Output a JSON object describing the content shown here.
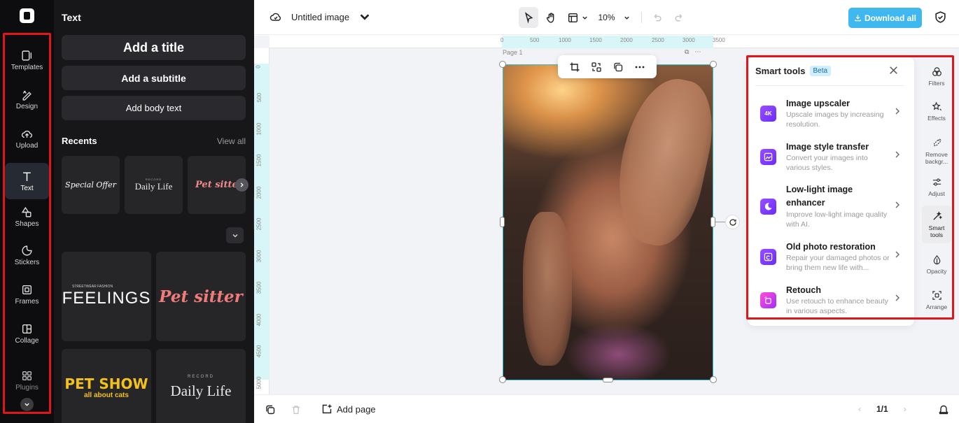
{
  "rail": {
    "items": [
      {
        "label": "Templates",
        "icon": "templates-icon"
      },
      {
        "label": "Design",
        "icon": "design-icon"
      },
      {
        "label": "Upload",
        "icon": "upload-icon"
      },
      {
        "label": "Text",
        "icon": "text-icon"
      },
      {
        "label": "Shapes",
        "icon": "shapes-icon"
      },
      {
        "label": "Stickers",
        "icon": "stickers-icon"
      },
      {
        "label": "Frames",
        "icon": "frames-icon"
      },
      {
        "label": "Collage",
        "icon": "collage-icon"
      },
      {
        "label": "Plugins",
        "icon": "plugins-icon"
      }
    ],
    "active": "Text"
  },
  "panel": {
    "title": "Text",
    "add_title": "Add a title",
    "add_subtitle": "Add a subtitle",
    "add_body": "Add body text",
    "recents_label": "Recents",
    "view_all": "View all",
    "recents": {
      "special_offer": "Special Offer",
      "daily_small": "RECORD",
      "daily_big": "Daily Life",
      "pet_sitter": "Pet sitter"
    },
    "templates": {
      "feelings_tiny": "STREETWEAR FASHION",
      "feelings": "FEELINGS",
      "pet_sitter": "Pet sitter",
      "pet_show": "PET SHOW",
      "pet_show_sub": "all about cats",
      "daily_small": "RECORD",
      "daily_big": "Daily Life"
    }
  },
  "topbar": {
    "doc_name": "Untitled image",
    "zoom": "10%",
    "download": "Download all"
  },
  "canvas": {
    "page_label": "Page 1",
    "ruler_top": [
      "0",
      "500",
      "1000",
      "1500",
      "2000",
      "2500",
      "3000",
      "3500"
    ],
    "ruler_left": [
      "0",
      "500",
      "1000",
      "1500",
      "2000",
      "2500",
      "3000",
      "3500",
      "4000",
      "4500",
      "5000"
    ]
  },
  "smart_tools": {
    "title": "Smart tools",
    "badge": "Beta",
    "items": [
      {
        "name": "Image upscaler",
        "desc": "Upscale images by increasing resolution.",
        "icon": "upscale-icon",
        "icon_text": "4K"
      },
      {
        "name": "Image style transfer",
        "desc": "Convert your images into various styles.",
        "icon": "style-transfer-icon",
        "icon_text": ""
      },
      {
        "name": "Low-light image enhancer",
        "desc": "Improve low-light image quality with AI.",
        "icon": "low-light-icon",
        "icon_text": ""
      },
      {
        "name": "Old photo restoration",
        "desc": "Repair your damaged photos or bring them new life with...",
        "icon": "restoration-icon",
        "icon_text": ""
      },
      {
        "name": "Retouch",
        "desc": "Use retouch to enhance beauty in various aspects.",
        "icon": "retouch-icon",
        "icon_text": ""
      }
    ]
  },
  "right_tools": [
    {
      "label": "Filters",
      "icon": "filters-icon"
    },
    {
      "label": "Effects",
      "icon": "effects-icon"
    },
    {
      "label": "Remove backgr...",
      "icon": "remove-background-icon"
    },
    {
      "label": "Adjust",
      "icon": "adjust-icon"
    },
    {
      "label": "Smart tools",
      "icon": "smart-tools-icon"
    },
    {
      "label": "Opacity",
      "icon": "opacity-icon"
    },
    {
      "label": "Arrange",
      "icon": "arrange-icon"
    }
  ],
  "bottombar": {
    "add_page": "Add page",
    "page_counter": "1/1"
  },
  "colors": {
    "accent": "#3fb8f0",
    "highlight_box": "#e0161b",
    "selection": "#2ec3cc",
    "smart_icon": "#7a3cff"
  }
}
